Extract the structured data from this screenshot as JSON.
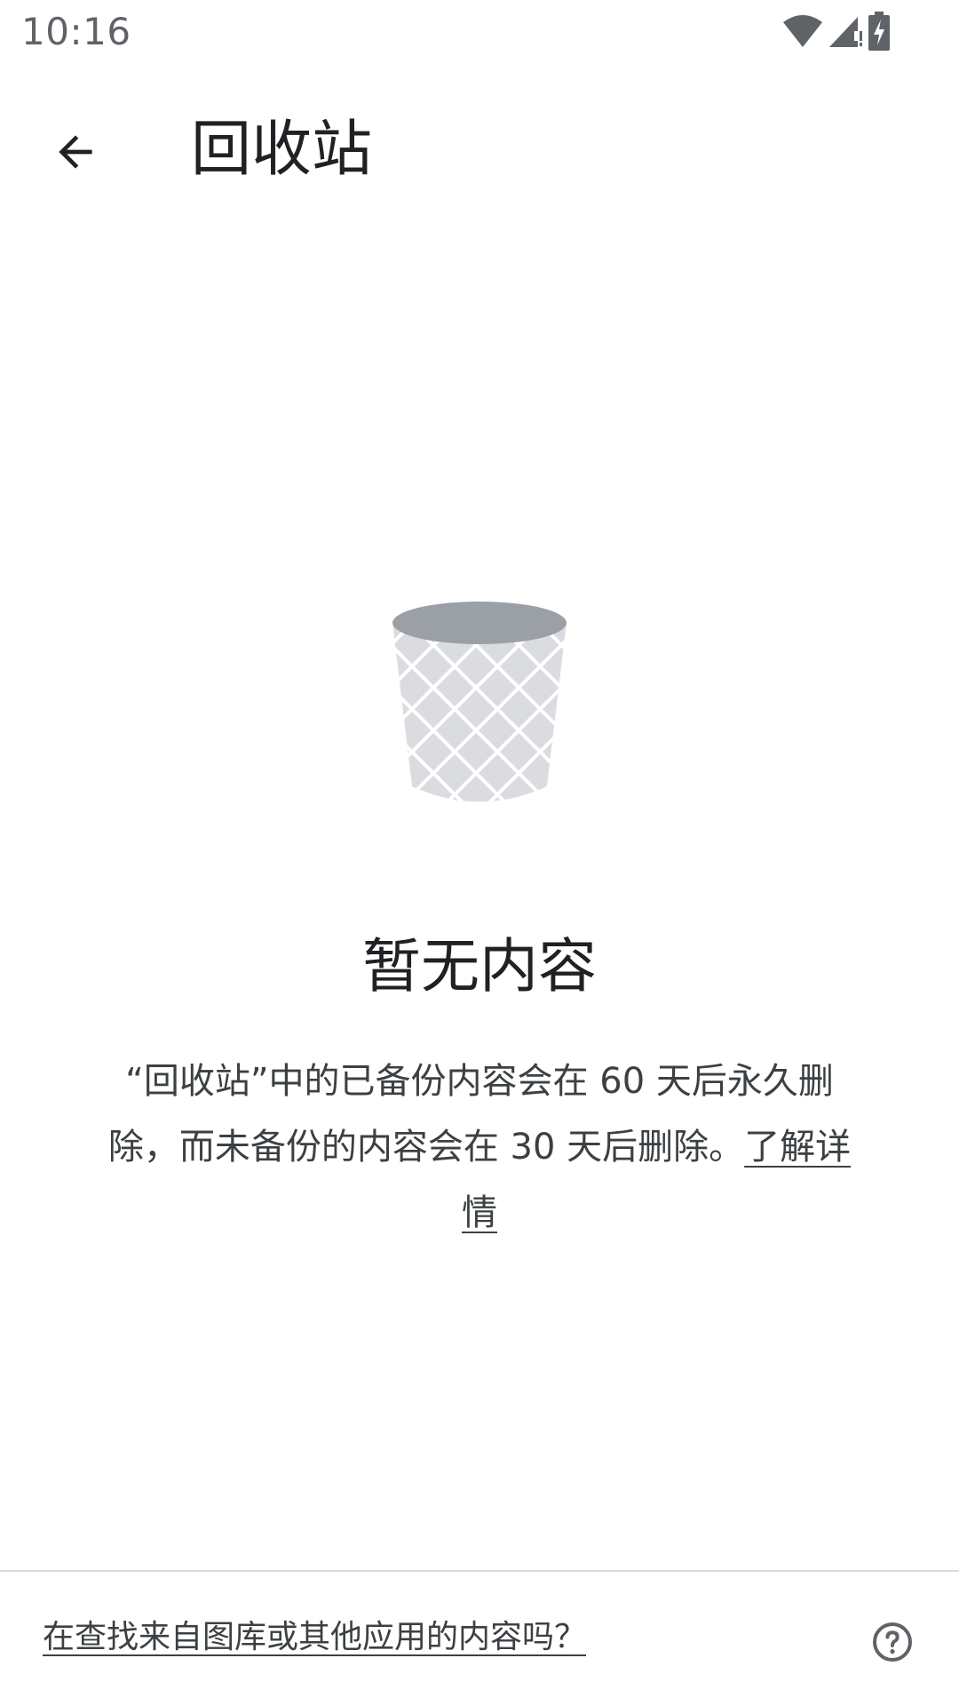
{
  "status_bar": {
    "time": "10:16",
    "icons": [
      "wifi-icon",
      "cell-signal-icon",
      "battery-charging-icon"
    ]
  },
  "app_bar": {
    "back_icon": "arrow-back-icon",
    "title": "回收站"
  },
  "empty_state": {
    "illustration": "trash-bin-icon",
    "title": "暂无内容",
    "description": "“回收站”中的已备份内容会在 60 天后永久删除，而未备份的内容会在 30 天后删除。",
    "learn_more": "了解详情"
  },
  "footer": {
    "link": "在查找来自图库或其他应用的内容吗？",
    "help_icon": "help-circle-icon"
  },
  "colors": {
    "text_primary": "#202124",
    "text_secondary": "#3c4043",
    "status_gray": "#5f6368",
    "trash_rim": "#9aa0a6",
    "trash_body": "#dadce0",
    "divider": "#dadce0"
  }
}
